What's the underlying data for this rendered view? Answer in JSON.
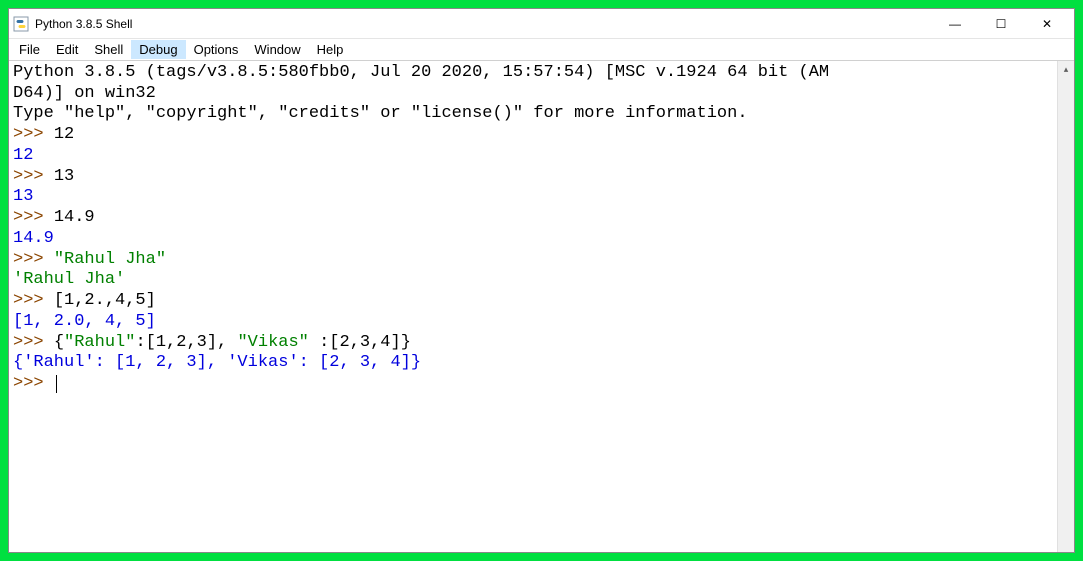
{
  "titlebar": {
    "title": "Python 3.8.5 Shell",
    "icon_name": "python-idle-icon",
    "controls": {
      "minimize": "—",
      "maximize": "☐",
      "close": "✕"
    }
  },
  "menubar": {
    "items": [
      "File",
      "Edit",
      "Shell",
      "Debug",
      "Options",
      "Window",
      "Help"
    ],
    "hovered_index": 3
  },
  "shell": {
    "banner1": "Python 3.8.5 (tags/v3.8.5:580fbb0, Jul 20 2020, 15:57:54) [MSC v.1924 64 bit (AM",
    "banner2": "D64)] on win32",
    "banner3": "Type \"help\", \"copyright\", \"credits\" or \"license()\" for more information.",
    "prompt": ">>> ",
    "lines": [
      {
        "type": "in",
        "text": "12"
      },
      {
        "type": "out_num",
        "text": "12"
      },
      {
        "type": "in",
        "text": "13"
      },
      {
        "type": "out_num",
        "text": "13"
      },
      {
        "type": "in",
        "text": "14.9"
      },
      {
        "type": "out_num",
        "text": "14.9"
      },
      {
        "type": "in_str",
        "text": "\"Rahul Jha\""
      },
      {
        "type": "out_str",
        "text": "'Rahul Jha'"
      },
      {
        "type": "in",
        "text": "[1,2.,4,5]"
      },
      {
        "type": "out_list",
        "text": "[1, 2.0, 4, 5]"
      },
      {
        "type": "in_dict",
        "pre": "{",
        "k1": "\"Rahul\"",
        "mid1": ":[1,2,3], ",
        "k2": "\"Vikas\"",
        "mid2": " :[2,3,4]}"
      },
      {
        "type": "out_list",
        "text": "{'Rahul': [1, 2, 3], 'Vikas': [2, 3, 4]}"
      },
      {
        "type": "prompt_only"
      }
    ]
  }
}
